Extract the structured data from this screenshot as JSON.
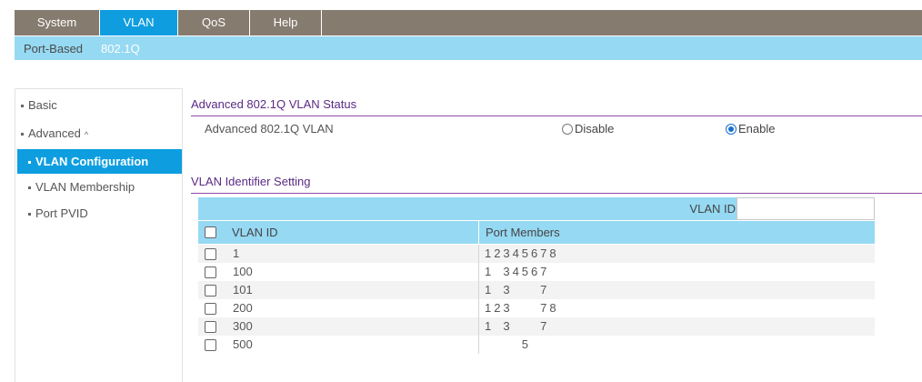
{
  "top_nav": {
    "tabs": [
      {
        "label": "System",
        "active": false
      },
      {
        "label": "VLAN",
        "active": true
      },
      {
        "label": "QoS",
        "active": false
      },
      {
        "label": "Help",
        "active": false
      }
    ]
  },
  "sub_nav": {
    "items": [
      {
        "label": "Port-Based",
        "active": false
      },
      {
        "label": "802.1Q",
        "active": true
      }
    ]
  },
  "sidebar": {
    "basic": "Basic",
    "advanced": "Advanced",
    "advanced_caret": "^",
    "items": [
      {
        "label": "VLAN Configuration",
        "active": true
      },
      {
        "label": "VLAN Membership",
        "active": false
      },
      {
        "label": "Port PVID",
        "active": false
      }
    ]
  },
  "status_section": {
    "title": "Advanced 802.1Q VLAN Status",
    "row_label": "Advanced 802.1Q VLAN",
    "option_disable": "Disable",
    "option_enable": "Enable",
    "selected": "Enable"
  },
  "identifier_section": {
    "title": "VLAN Identifier Setting",
    "vlan_id_label": "VLAN ID",
    "vlan_id_value": "",
    "columns": {
      "vlan_id": "VLAN ID",
      "port_members": "Port Members"
    },
    "rows": [
      {
        "vlan_id": "1",
        "ports": [
          "1",
          "2",
          "3",
          "4",
          "5",
          "6",
          "7",
          "8"
        ]
      },
      {
        "vlan_id": "100",
        "ports": [
          "1",
          "",
          "3",
          "4",
          "5",
          "6",
          "7",
          ""
        ]
      },
      {
        "vlan_id": "101",
        "ports": [
          "1",
          "",
          "3",
          "",
          "",
          "",
          "7",
          ""
        ]
      },
      {
        "vlan_id": "200",
        "ports": [
          "1",
          "2",
          "3",
          "",
          "",
          "",
          "7",
          "8"
        ]
      },
      {
        "vlan_id": "300",
        "ports": [
          "1",
          "",
          "3",
          "",
          "",
          "",
          "7",
          ""
        ]
      },
      {
        "vlan_id": "500",
        "ports": [
          "",
          "",
          "",
          "",
          "5",
          "",
          "",
          ""
        ]
      }
    ]
  }
}
